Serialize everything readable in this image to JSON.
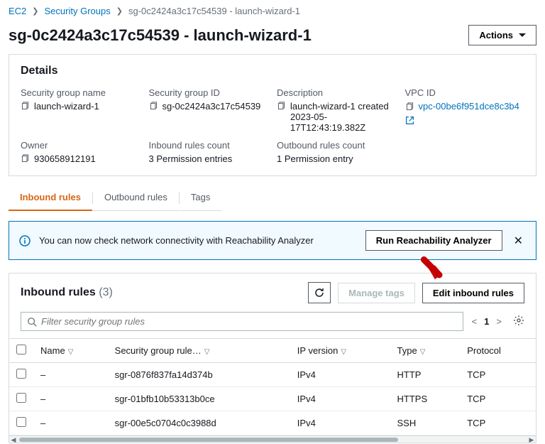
{
  "breadcrumb": {
    "root": "EC2",
    "parent": "Security Groups",
    "current": "sg-0c2424a3c17c54539 - launch-wizard-1"
  },
  "header": {
    "title": "sg-0c2424a3c17c54539 - launch-wizard-1",
    "actions_label": "Actions"
  },
  "details": {
    "title": "Details",
    "items": {
      "security_group_name": {
        "label": "Security group name",
        "value": "launch-wizard-1"
      },
      "security_group_id": {
        "label": "Security group ID",
        "value": "sg-0c2424a3c17c54539"
      },
      "description": {
        "label": "Description",
        "value": "launch-wizard-1 created 2023-05-17T12:43:19.382Z"
      },
      "vpc_id": {
        "label": "VPC ID",
        "value": "vpc-00be6f951dce8c3b4"
      },
      "owner": {
        "label": "Owner",
        "value": "930658912191"
      },
      "inbound_count": {
        "label": "Inbound rules count",
        "value": "3 Permission entries"
      },
      "outbound_count": {
        "label": "Outbound rules count",
        "value": "1 Permission entry"
      }
    }
  },
  "tabs": {
    "inbound": "Inbound rules",
    "outbound": "Outbound rules",
    "tags": "Tags"
  },
  "banner": {
    "text": "You can now check network connectivity with Reachability Analyzer",
    "button": "Run Reachability Analyzer"
  },
  "rules": {
    "title": "Inbound rules",
    "count": "(3)",
    "manage_tags": "Manage tags",
    "edit": "Edit inbound rules",
    "search_placeholder": "Filter security group rules",
    "page": "1",
    "columns": {
      "name": "Name",
      "rule_id": "Security group rule…",
      "ip_version": "IP version",
      "type": "Type",
      "protocol": "Protocol"
    },
    "rows": [
      {
        "name": "–",
        "rule_id": "sgr-0876f837fa14d374b",
        "ip_version": "IPv4",
        "type": "HTTP",
        "protocol": "TCP"
      },
      {
        "name": "–",
        "rule_id": "sgr-01bfb10b53313b0ce",
        "ip_version": "IPv4",
        "type": "HTTPS",
        "protocol": "TCP"
      },
      {
        "name": "–",
        "rule_id": "sgr-00e5c0704c0c3988d",
        "ip_version": "IPv4",
        "type": "SSH",
        "protocol": "TCP"
      }
    ]
  }
}
